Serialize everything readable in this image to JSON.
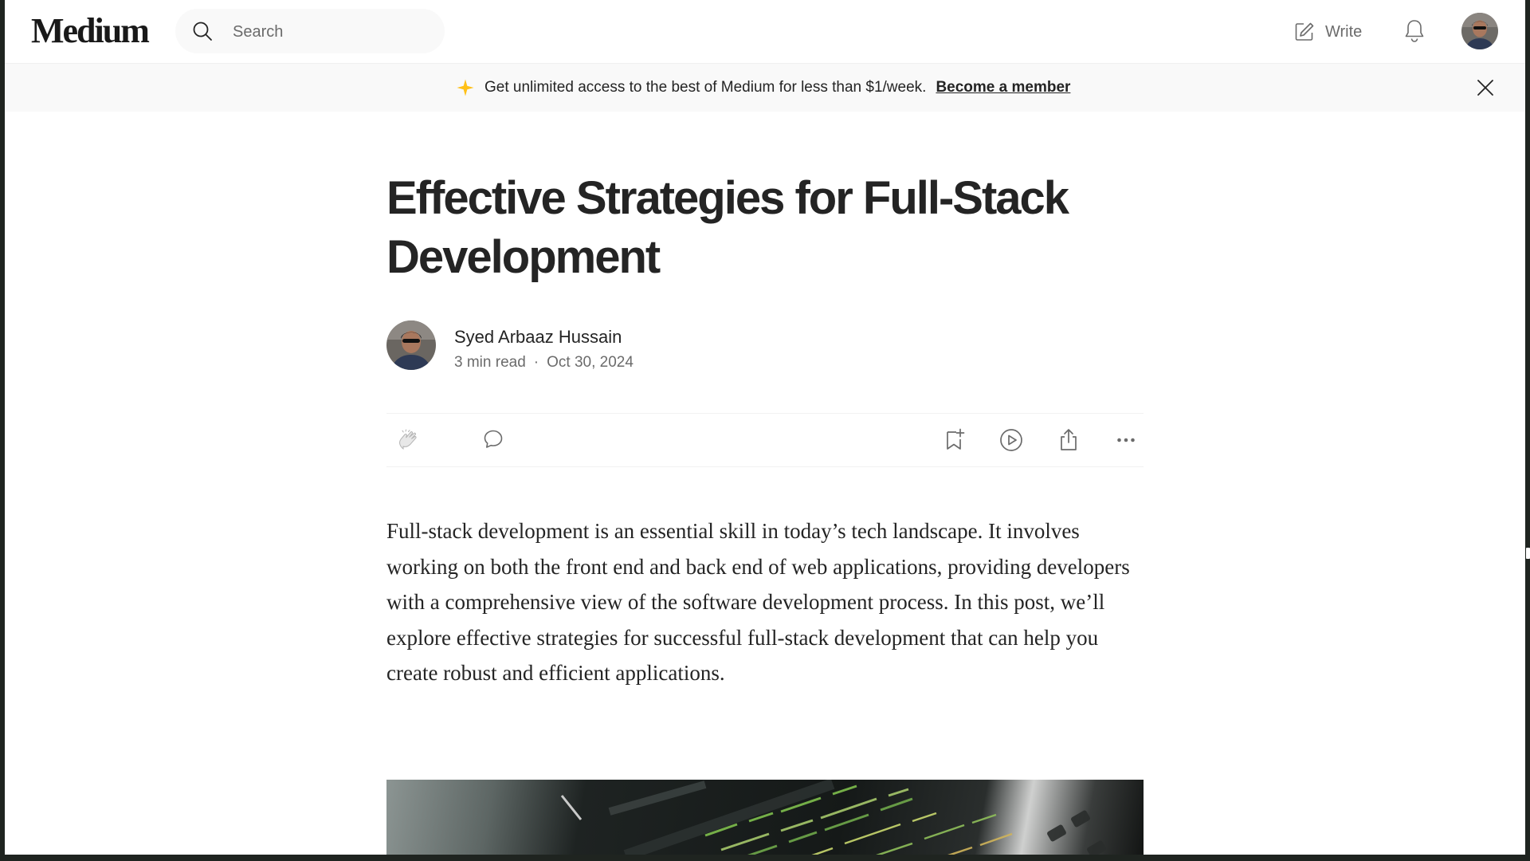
{
  "header": {
    "logo": "Medium",
    "search": {
      "placeholder": "Search"
    },
    "write_label": "Write"
  },
  "banner": {
    "text": "Get unlimited access to the best of Medium for less than $1/week.",
    "link_label": "Become a member"
  },
  "article": {
    "title": "Effective Strategies for Full-Stack Development",
    "author": "Syed Arbaaz Hussain",
    "read_time": "3 min read",
    "separator": "·",
    "date": "Oct 30, 2024",
    "body": "Full-stack development is an essential skill in today’s tech landscape. It involves working on both the front end and back end of web applications, providing developers with a comprehensive view of the software development process. In this post, we’ll explore effective strategies for successful full-stack development that can help you create robust and efficient applications."
  },
  "icons": {
    "search": "search-icon",
    "write": "pencil-square-icon",
    "notifications": "bell-icon",
    "banner": "sparkle-icon",
    "close": "close-icon",
    "clap": "clap-icon",
    "response": "comment-icon",
    "save": "bookmark-add-icon",
    "listen": "play-icon",
    "share": "share-icon",
    "more": "more-icon"
  },
  "colors": {
    "text": "#242424",
    "muted": "#6b6b6b",
    "banner_bg": "#f9f9f9",
    "sparkle": "#ffc017"
  }
}
